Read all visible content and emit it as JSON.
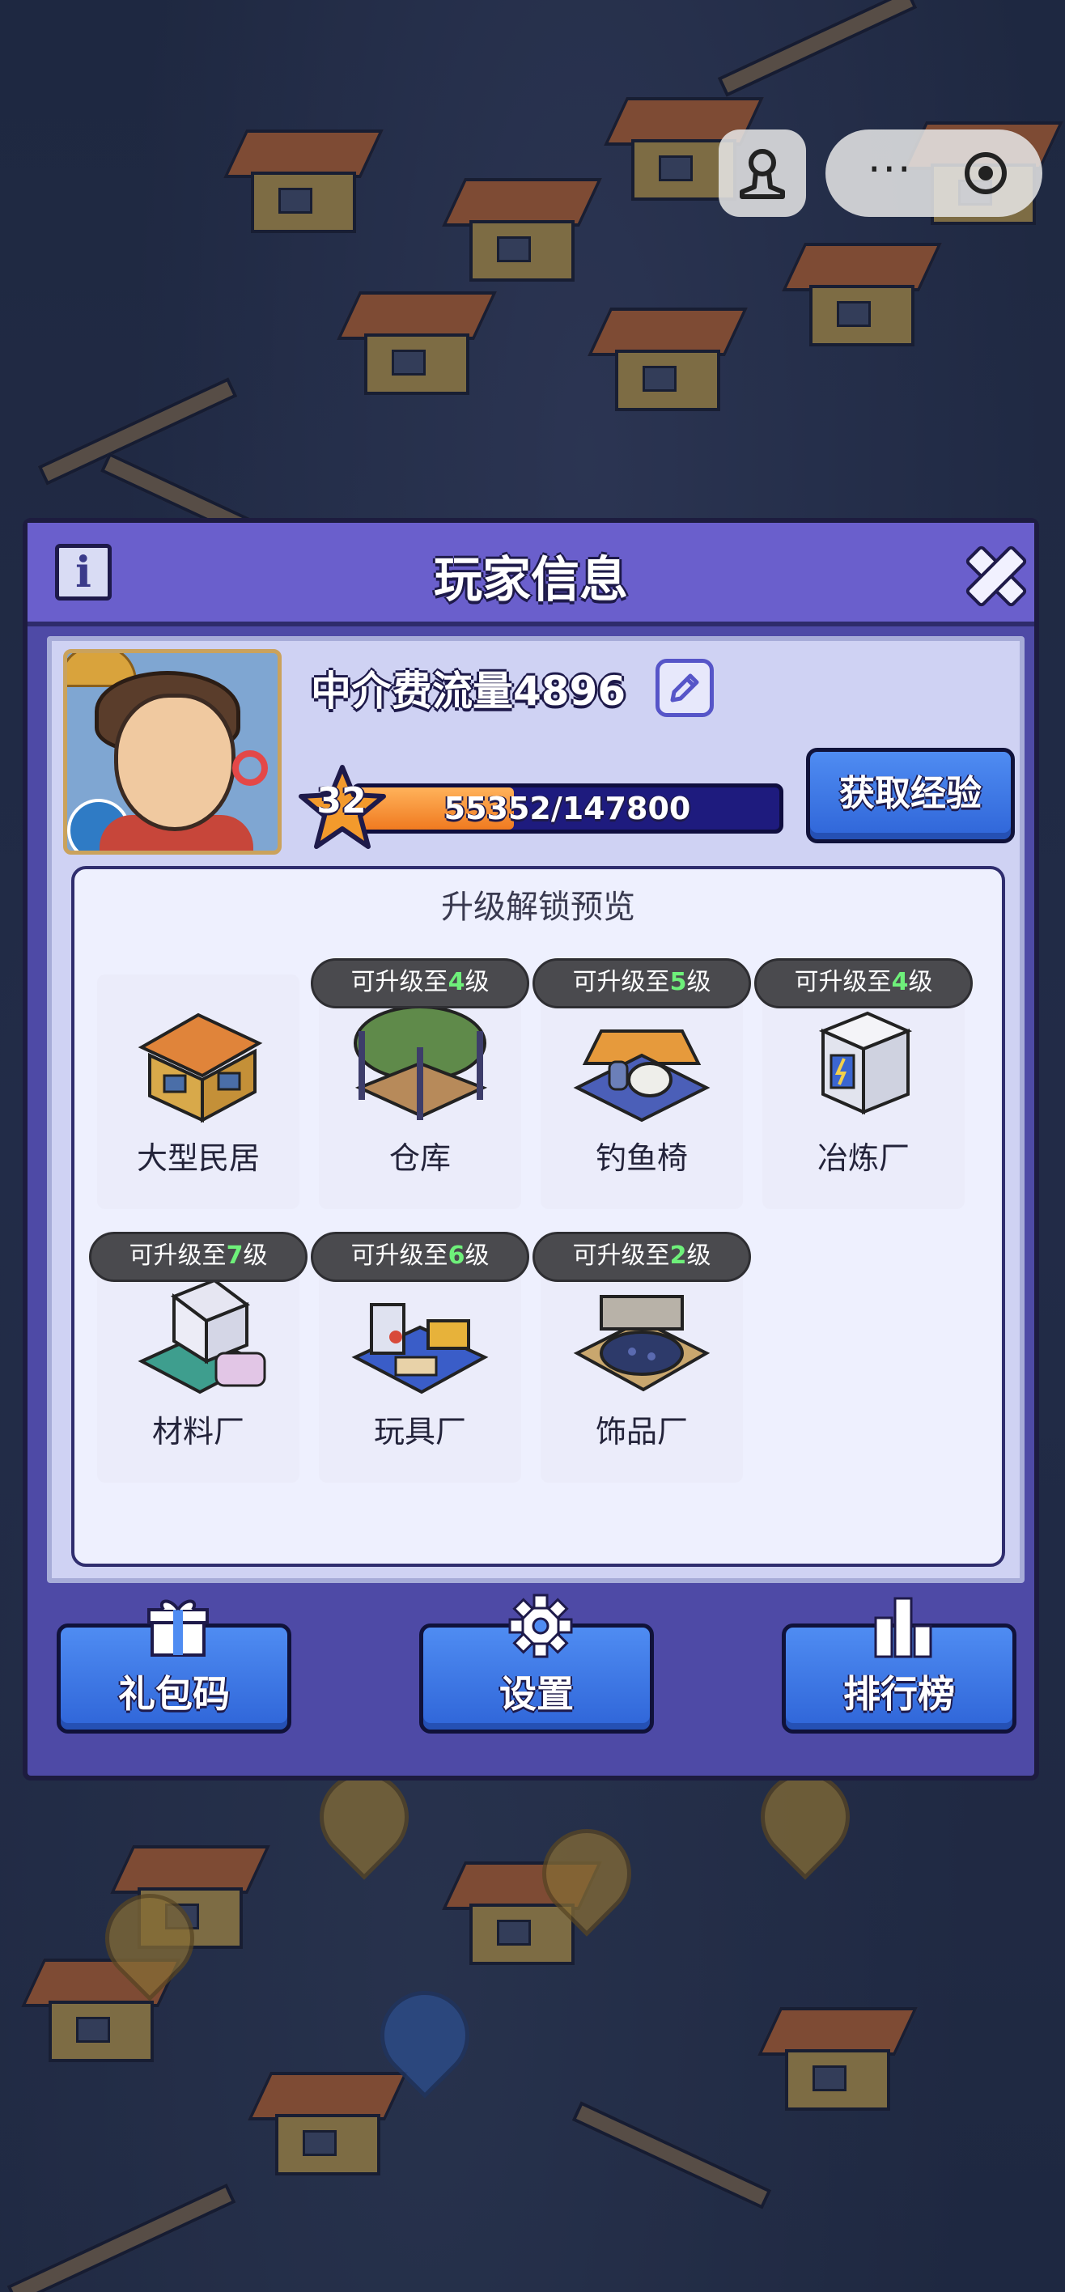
{
  "capsule": {
    "menu_icon": "more-dots-icon",
    "close_icon": "target-icon",
    "profile_icon": "joystick-icon",
    "dots": "···"
  },
  "panel": {
    "title": "玩家信息",
    "info_icon": "i"
  },
  "player": {
    "name": "中介费流量4896",
    "level": "32",
    "xp_text": "55352/147800",
    "xp_fraction": 0.3745,
    "exp_button": "获取经验"
  },
  "preview": {
    "title": "升级解锁预览",
    "buildings": [
      {
        "name": "大型民居",
        "badge_prefix": "",
        "badge_level": "",
        "badge_suffix": ""
      },
      {
        "name": "仓库",
        "badge_prefix": "可升级至",
        "badge_level": "4",
        "badge_suffix": "级"
      },
      {
        "name": "钓鱼椅",
        "badge_prefix": "可升级至",
        "badge_level": "5",
        "badge_suffix": "级"
      },
      {
        "name": "冶炼厂",
        "badge_prefix": "可升级至",
        "badge_level": "4",
        "badge_suffix": "级"
      },
      {
        "name": "材料厂",
        "badge_prefix": "可升级至",
        "badge_level": "7",
        "badge_suffix": "级"
      },
      {
        "name": "玩具厂",
        "badge_prefix": "可升级至",
        "badge_level": "6",
        "badge_suffix": "级"
      },
      {
        "name": "饰品厂",
        "badge_prefix": "可升级至",
        "badge_level": "2",
        "badge_suffix": "级"
      }
    ]
  },
  "bottom": {
    "gift": "礼包码",
    "settings": "设置",
    "rank": "排行榜"
  },
  "colors": {
    "panel": "#4e4aa6",
    "header": "#6a5fcc",
    "button": "#3f78e6",
    "badge_level": "#6ef07a"
  }
}
